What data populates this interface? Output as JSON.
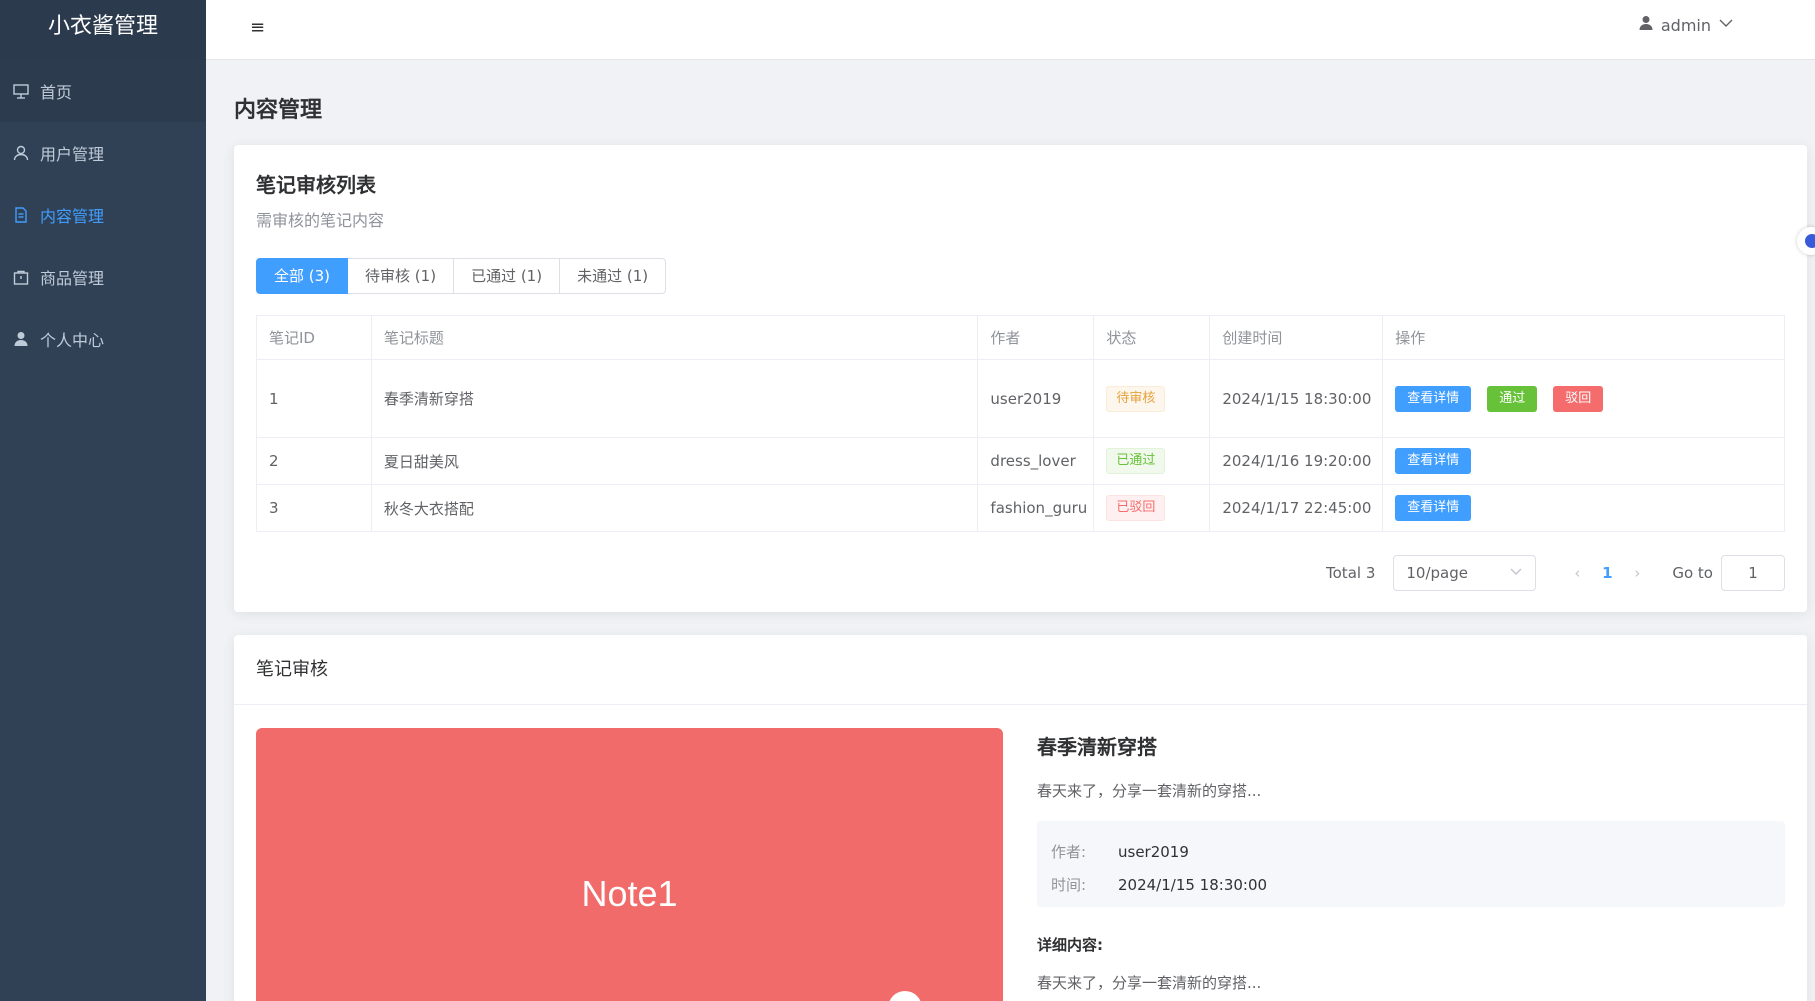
{
  "app": {
    "brand": "小衣酱管理"
  },
  "sidebar": {
    "items": [
      {
        "label": "首页",
        "icon": "monitor-icon"
      },
      {
        "label": "用户管理",
        "icon": "user-outline-icon"
      },
      {
        "label": "内容管理",
        "icon": "document-icon",
        "active": true
      },
      {
        "label": "商品管理",
        "icon": "shopping-bag-icon"
      },
      {
        "label": "个人中心",
        "icon": "user-solid-icon"
      }
    ]
  },
  "header": {
    "menu_toggle": "≡",
    "user": "admin"
  },
  "page": {
    "title": "内容管理"
  },
  "list_card": {
    "title": "笔记审核列表",
    "subtitle": "需审核的笔记内容",
    "tabs": [
      "全部 (3)",
      "待审核 (1)",
      "已通过 (1)",
      "未通过 (1)"
    ],
    "columns": [
      "笔记ID",
      "笔记标题",
      "作者",
      "状态",
      "创建时间",
      "操作"
    ],
    "rows": [
      {
        "id": "1",
        "title": "春季清新穿搭",
        "author": "user2019",
        "status": "待审核",
        "created": "2024/1/15 18:30:00"
      },
      {
        "id": "2",
        "title": "夏日甜美风",
        "author": "dress_lover",
        "status": "已通过",
        "created": "2024/1/16 19:20:00"
      },
      {
        "id": "3",
        "title": "秋冬大衣搭配",
        "author": "fashion_guru",
        "status": "已驳回",
        "created": "2024/1/17 22:45:00"
      }
    ],
    "actions": {
      "view": "查看详情",
      "approve": "通过",
      "reject": "驳回"
    },
    "pagination": {
      "total": "Total 3",
      "page_size": "10/page",
      "current": "1",
      "goto_label": "Go to",
      "goto_value": "1"
    }
  },
  "review_card": {
    "title": "笔记审核",
    "image_label": "Note1",
    "note_title": "春季清新穿搭",
    "summary": "春天来了，分享一套清新的穿搭...",
    "meta": {
      "author_key": "作者:",
      "author": "user2019",
      "time_key": "时间:",
      "time": "2024/1/15 18:30:00"
    },
    "detail_heading": "详细内容:",
    "detail_body": "春天来了，分享一套清新的穿搭..."
  },
  "colors": {
    "sidebar": "#304156",
    "primary": "#409eff",
    "success": "#67c23a",
    "danger": "#f56c6c",
    "warning": "#e6a23c",
    "note_image": "#f26b6b"
  }
}
